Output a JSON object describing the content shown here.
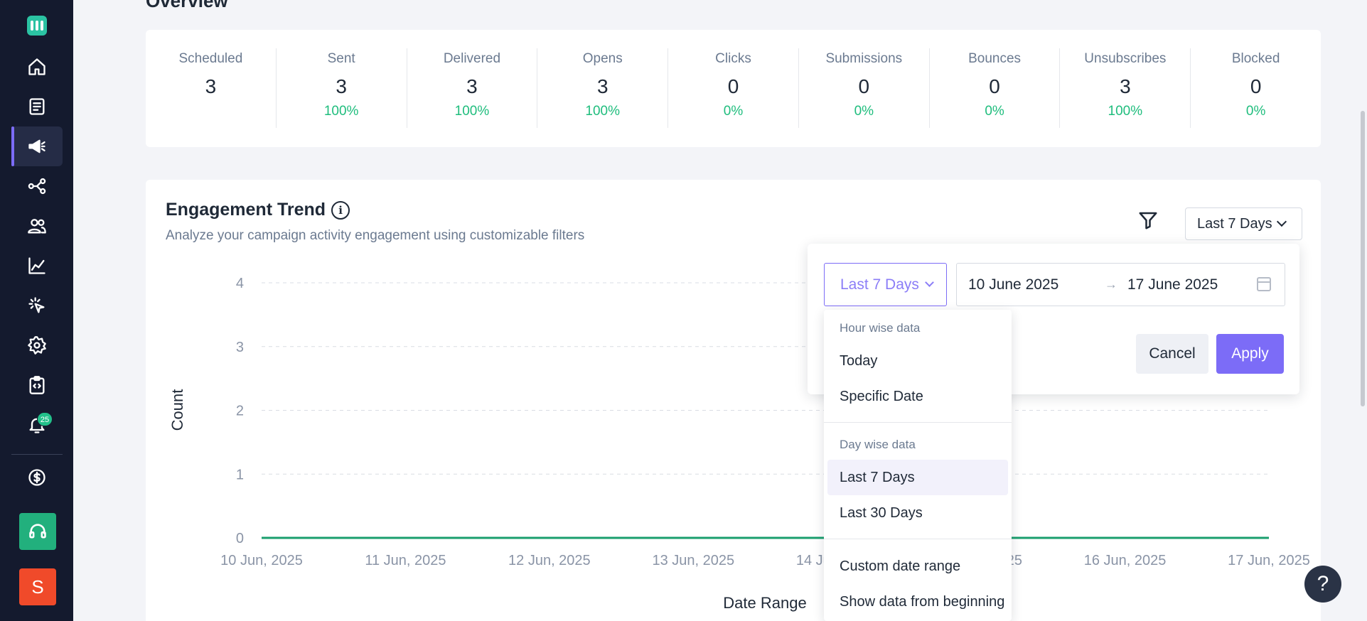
{
  "sidebar": {
    "logo_icon": "logo-icon",
    "items": [
      {
        "name": "home-icon"
      },
      {
        "name": "document-icon"
      },
      {
        "name": "megaphone-icon"
      },
      {
        "name": "share-nodes-icon"
      },
      {
        "name": "users-icon"
      },
      {
        "name": "chart-line-icon"
      },
      {
        "name": "cursor-click-icon"
      },
      {
        "name": "gear-icon"
      },
      {
        "name": "code-clipboard-icon"
      },
      {
        "name": "bell-icon"
      }
    ],
    "active_index": 2,
    "notification_count": "25",
    "billing_icon": "dollar-icon",
    "support_icon": "headphones-icon",
    "avatar_initial": "S",
    "avatar_color": "#f04a2a"
  },
  "overview": {
    "title": "Overview",
    "stats": [
      {
        "label": "Scheduled",
        "value": "3",
        "pct": ""
      },
      {
        "label": "Sent",
        "value": "3",
        "pct": "100%"
      },
      {
        "label": "Delivered",
        "value": "3",
        "pct": "100%"
      },
      {
        "label": "Opens",
        "value": "3",
        "pct": "100%"
      },
      {
        "label": "Clicks",
        "value": "0",
        "pct": "0%"
      },
      {
        "label": "Submissions",
        "value": "0",
        "pct": "0%"
      },
      {
        "label": "Bounces",
        "value": "0",
        "pct": "0%"
      },
      {
        "label": "Unsubscribes",
        "value": "3",
        "pct": "100%"
      },
      {
        "label": "Blocked",
        "value": "0",
        "pct": "0%"
      }
    ]
  },
  "trend": {
    "title": "Engagement Trend",
    "info_icon": "i",
    "subtitle": "Analyze your campaign activity engagement using customizable filters",
    "range_label": "Last 7 Days"
  },
  "chart_data": {
    "type": "line",
    "ylabel": "Count",
    "xlabel": "Date Range",
    "ylim": [
      0,
      4
    ],
    "yticks": [
      "4",
      "3",
      "2",
      "1",
      "0"
    ],
    "x": [
      "10 Jun, 2025",
      "11 Jun, 2025",
      "12 Jun, 2025",
      "13 Jun, 2025",
      "14 Jun, 2025",
      "15 Jun, 2025",
      "16 Jun, 2025",
      "17 Jun, 2025"
    ],
    "series": [
      {
        "values": [
          0,
          0,
          0,
          0,
          0,
          0,
          0,
          0
        ],
        "color": "#1a9e6e"
      }
    ],
    "grid": true
  },
  "popover": {
    "preset_label": "Last 7 Days",
    "start_date": "10 June 2025",
    "end_date": "17 June 2025",
    "arrow": "→",
    "cancel_label": "Cancel",
    "apply_label": "Apply"
  },
  "menu": {
    "groups": [
      {
        "label": "Hour wise data",
        "items": [
          "Today",
          "Specific Date"
        ]
      },
      {
        "label": "Day wise data",
        "items": [
          "Last 7 Days",
          "Last 30 Days"
        ]
      },
      {
        "label": "",
        "items": [
          "Custom date range",
          "Show data from beginning"
        ]
      }
    ],
    "selected": "Last 7 Days"
  },
  "help_label": "?",
  "colors": {
    "accent": "#7c6cf7",
    "positive": "#1fbd7d",
    "sidebar_bg": "#141a2e"
  }
}
